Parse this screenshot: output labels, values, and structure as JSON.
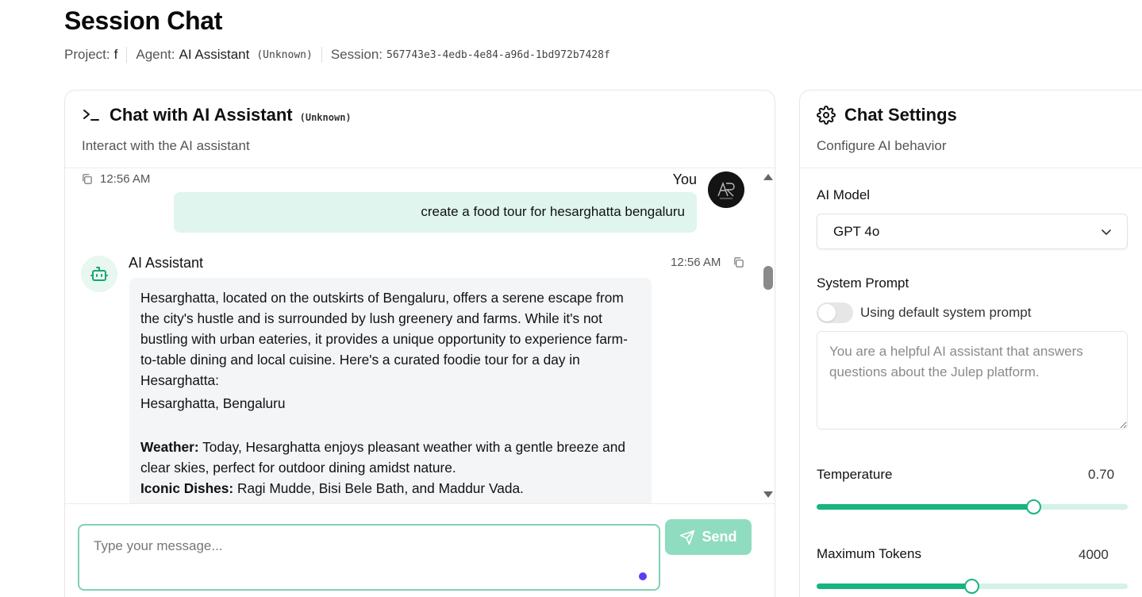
{
  "page": {
    "title": "Session Chat",
    "project_label": "Project:",
    "project_value": "f",
    "agent_label": "Agent:",
    "agent_value": "AI Assistant",
    "agent_status": "(Unknown)",
    "session_label": "Session:",
    "session_value": "567743e3-4edb-4e84-a96d-1bd972b7428f"
  },
  "chat": {
    "title": "Chat with AI Assistant",
    "badge": "(Unknown)",
    "subtitle": "Interact with the AI assistant",
    "partial_time": "12:56 AM",
    "messages": [
      {
        "role": "user",
        "name": "You",
        "text": "create a food tour for hesarghatta bengaluru"
      },
      {
        "role": "assistant",
        "name": "AI Assistant",
        "time": "12:56 AM",
        "paragraphs": [
          "Hesarghatta, located on the outskirts of Bengaluru, offers a serene escape from the city's hustle and is surrounded by lush greenery and farms. While it's not bustling with urban eateries, it provides a unique opportunity to experience farm-to-table dining and local cuisine. Here's a curated foodie tour for a day in Hesarghatta:",
          "Hesarghatta, Bengaluru"
        ],
        "weather_label": "Weather:",
        "weather_text": " Today, Hesarghatta enjoys pleasant weather with a gentle breeze and clear skies, perfect for outdoor dining amidst nature.",
        "dishes_label": "Iconic Dishes:",
        "dishes_text": " Ragi Mudde, Bisi Bele Bath, and Maddur Vada."
      }
    ],
    "input_placeholder": "Type your message...",
    "send_label": "Send"
  },
  "settings": {
    "title": "Chat Settings",
    "subtitle": "Configure AI behavior",
    "model_label": "AI Model",
    "model_value": "GPT 4o",
    "prompt_label": "System Prompt",
    "toggle_label": "Using default system prompt",
    "toggle_on": false,
    "prompt_placeholder": "You are a helpful AI assistant that answers questions about the Julep platform.",
    "temperature_label": "Temperature",
    "temperature_value": "0.70",
    "temperature_fraction": 0.7,
    "tokens_label": "Maximum Tokens",
    "tokens_value": "4000",
    "tokens_fraction": 0.5
  },
  "colors": {
    "accent": "#17b482",
    "user_bubble": "#dff5ed",
    "bot_bubble": "#f4f5f6",
    "send_button": "#8fdcc0"
  },
  "icons": [
    "terminal-icon",
    "copy-icon",
    "bot-icon",
    "gear-icon",
    "chevron-down-icon",
    "send-icon"
  ]
}
